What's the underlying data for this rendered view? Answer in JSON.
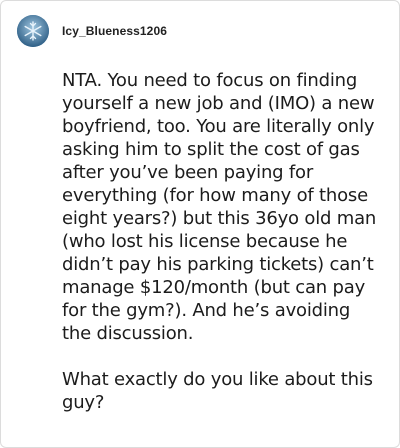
{
  "comment": {
    "author": "Icy_Blueness1206",
    "avatar_icon": "snowflake-avatar-icon",
    "paragraphs": [
      "NTA. You need to focus on finding yourself a new job and (IMO) a new boyfriend, too. You are literally only asking him to split the cost of gas after you’ve been paying for everything (for how many of those eight years?) but this 36yo old man (who lost his license because he didn’t pay his parking tickets) can’t manage $120/month (but can pay for the gym?). And he’s avoiding the discussion.",
      "What exactly do you like about this guy?"
    ]
  },
  "colors": {
    "border": "#dcdcdc",
    "text": "#1c1c1c",
    "avatar_bg": "#5a8fb7"
  }
}
